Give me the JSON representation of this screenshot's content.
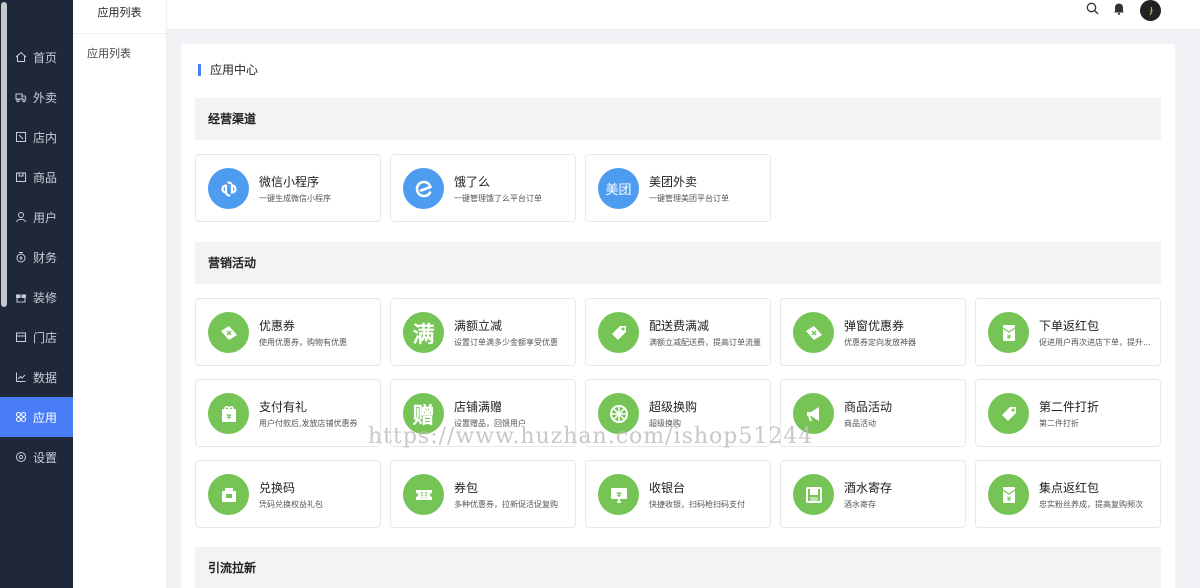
{
  "sidebar": {
    "items": [
      {
        "label": "首页",
        "icon": "home-icon"
      },
      {
        "label": "外卖",
        "icon": "delivery-icon"
      },
      {
        "label": "店内",
        "icon": "dine-in-icon"
      },
      {
        "label": "商品",
        "icon": "goods-icon"
      },
      {
        "label": "用户",
        "icon": "user-icon"
      },
      {
        "label": "财务",
        "icon": "finance-icon"
      },
      {
        "label": "装修",
        "icon": "decorate-icon"
      },
      {
        "label": "门店",
        "icon": "store-icon"
      },
      {
        "label": "数据",
        "icon": "chart-icon"
      },
      {
        "label": "应用",
        "icon": "apps-icon"
      },
      {
        "label": "设置",
        "icon": "gear-icon"
      }
    ],
    "active_index": 9
  },
  "submenu": {
    "title": "应用列表",
    "items": [
      "应用列表"
    ]
  },
  "topbar": {
    "icons": [
      "search-icon",
      "bell-icon",
      "avatar"
    ]
  },
  "panel": {
    "title": "应用中心",
    "sections": [
      {
        "title": "经营渠道",
        "cards": [
          {
            "title": "微信小程序",
            "desc": "一键生成微信小程序",
            "icon": "mini-program-icon",
            "color": "#4e9cf0"
          },
          {
            "title": "饿了么",
            "desc": "一键管理饿了么平台订单",
            "icon": "eleme-icon",
            "color": "#4e9cf0"
          },
          {
            "title": "美团外卖",
            "desc": "一键管理美团平台订单",
            "icon": "meituan-icon",
            "color": "#4e9cf0"
          }
        ]
      },
      {
        "title": "营销活动",
        "cards": [
          {
            "title": "优惠券",
            "desc": "使用优惠券，购物有优惠",
            "icon": "coupon-icon",
            "color": "#76c356"
          },
          {
            "title": "满额立减",
            "desc": "设置订单满多少金额享受优惠",
            "icon": "full-reduction-icon",
            "color": "#76c356"
          },
          {
            "title": "配送费满减",
            "desc": "满额立减配送费，提高订单流量",
            "icon": "tag-icon",
            "color": "#76c356"
          },
          {
            "title": "弹窗优惠券",
            "desc": "优惠券定向发放神器",
            "icon": "popup-coupon-icon",
            "color": "#76c356"
          },
          {
            "title": "下单返红包",
            "desc": "促进用户再次进店下单，提升复购",
            "icon": "red-envelope-icon",
            "color": "#76c356"
          },
          {
            "title": "支付有礼",
            "desc": "用户付款后,发放店铺优惠券",
            "icon": "gift-bag-icon",
            "color": "#76c356"
          },
          {
            "title": "店铺满赠",
            "desc": "设置赠品，回馈用户",
            "icon": "gift-text-icon",
            "color": "#76c356"
          },
          {
            "title": "超级换购",
            "desc": "超级换购",
            "icon": "wheel-icon",
            "color": "#76c356"
          },
          {
            "title": "商品活动",
            "desc": "商品活动",
            "icon": "megaphone-icon",
            "color": "#76c356"
          },
          {
            "title": "第二件打折",
            "desc": "第二件打折",
            "icon": "discount-tag-icon",
            "color": "#76c356"
          },
          {
            "title": "兑换码",
            "desc": "凭码兑换权益礼包",
            "icon": "redeem-icon",
            "color": "#76c356"
          },
          {
            "title": "券包",
            "desc": "多种优惠券，拉新促活促复购",
            "icon": "ticket-icon",
            "color": "#76c356"
          },
          {
            "title": "收银台",
            "desc": "快捷收银，扫码枪扫码支付",
            "icon": "cashier-icon",
            "color": "#76c356"
          },
          {
            "title": "酒水寄存",
            "desc": "酒水寄存",
            "icon": "storage-icon",
            "color": "#76c356"
          },
          {
            "title": "集点返红包",
            "desc": "忠实粉丝养成，提高复购频次",
            "icon": "points-envelope-icon",
            "color": "#76c356"
          }
        ]
      },
      {
        "title": "引流拉新",
        "cards": []
      }
    ]
  },
  "watermark": "https://www.huzhan.com/ishop51244"
}
